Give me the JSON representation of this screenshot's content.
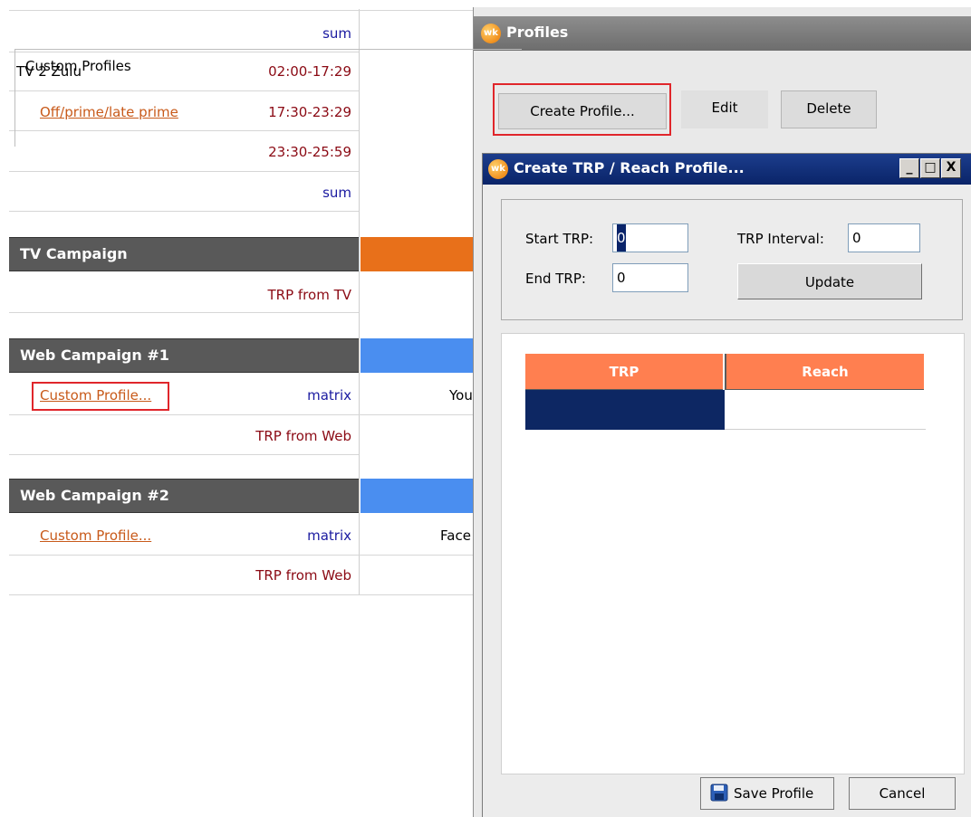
{
  "sheet": {
    "top_sum_label": "sum",
    "rows": [
      {
        "name": "TV 2 Zulu",
        "time": "02:00-17:29"
      },
      {
        "name": "Off/prime/late prime",
        "time": "17:30-23:29"
      },
      {
        "name": "",
        "time": "23:30-25:59"
      }
    ],
    "sum_label": "sum",
    "tv_campaign": {
      "title": "TV Campaign",
      "trp_label": "TRP from TV",
      "color": "#e8701a"
    },
    "web1": {
      "title": "Web Campaign #1",
      "link": "Custom Profile...",
      "type": "matrix",
      "partial": "You",
      "trp_label": "TRP from Web",
      "color": "#4a8ef0"
    },
    "web2": {
      "title": "Web Campaign #2",
      "link": "Custom Profile...",
      "type": "matrix",
      "partial": "Face",
      "trp_label": "TRP from Web",
      "color": "#4a8ef0"
    }
  },
  "profiles": {
    "logo": "wk",
    "title": "Profiles",
    "group_label": "Custom Profiles",
    "buttons": {
      "create": "Create Profile...",
      "edit": "Edit",
      "delete": "Delete"
    }
  },
  "dialog": {
    "logo": "wk",
    "title": "Create TRP / Reach Profile...",
    "window_buttons": {
      "minimize": "_",
      "maximize": "□",
      "close": "X"
    },
    "start_trp_label": "Start TRP:",
    "start_trp_value": "0",
    "end_trp_label": "End TRP:",
    "end_trp_value": "0",
    "interval_label": "TRP Interval:",
    "interval_value": "0",
    "update_label": "Update",
    "table_headers": [
      "TRP",
      "Reach"
    ],
    "save_label": "Save Profile",
    "cancel_label": "Cancel"
  },
  "colors": {
    "accent_header": "#ff7f50",
    "dialog_title": "#0a2468",
    "selection": "#0d2763",
    "highlight_box": "#e0262b"
  }
}
